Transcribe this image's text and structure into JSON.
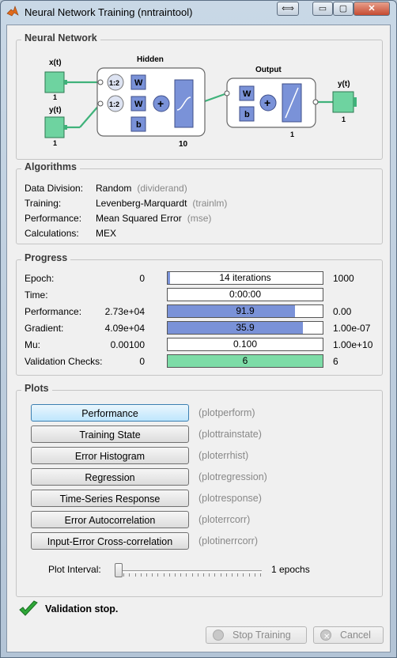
{
  "window": {
    "title": "Neural Network Training (nntraintool)",
    "controls": {
      "restore": "⟺",
      "minimize": "▭",
      "maximize": "▢",
      "close": "✕"
    }
  },
  "network": {
    "panel_title": "Neural Network",
    "input1_label": "x(t)",
    "input1_size": "1",
    "input2_label": "y(t)",
    "input2_size": "1",
    "hidden_title": "Hidden",
    "hidden_size": "10",
    "delay1": "1:2",
    "delay2": "1:2",
    "w_hidden_1": "W",
    "w_hidden_2": "W",
    "b_hidden": "b",
    "sum_hidden": "+",
    "output_title": "Output",
    "output_size": "1",
    "w_output": "W",
    "b_output": "b",
    "sum_output": "+",
    "output_label": "y(t)",
    "output_dim": "1"
  },
  "algorithms": {
    "panel_title": "Algorithms",
    "rows": [
      {
        "label": "Data Division:",
        "value": "Random",
        "fn": "(dividerand)"
      },
      {
        "label": "Training:",
        "value": "Levenberg-Marquardt",
        "fn": "(trainlm)"
      },
      {
        "label": "Performance:",
        "value": "Mean Squared Error",
        "fn": "(mse)"
      },
      {
        "label": "Calculations:",
        "value": "MEX",
        "fn": ""
      }
    ]
  },
  "progress": {
    "panel_title": "Progress",
    "rows": [
      {
        "label": "Epoch:",
        "start": "0",
        "value": "14 iterations",
        "end": "1000",
        "fill": 0.014,
        "color": "#7a92d8"
      },
      {
        "label": "Time:",
        "start": "",
        "value": "0:00:00",
        "end": "",
        "fill": 0,
        "color": "#7a92d8"
      },
      {
        "label": "Performance:",
        "start": "2.73e+04",
        "value": "91.9",
        "end": "0.00",
        "fill": 0.82,
        "color": "#7a92d8"
      },
      {
        "label": "Gradient:",
        "start": "4.09e+04",
        "value": "35.9",
        "end": "1.00e-07",
        "fill": 0.87,
        "color": "#7a92d8"
      },
      {
        "label": "Mu:",
        "start": "0.00100",
        "value": "0.100",
        "end": "1.00e+10",
        "fill": 0,
        "color": "#7a92d8"
      },
      {
        "label": "Validation Checks:",
        "start": "0",
        "value": "6",
        "end": "6",
        "fill": 1.0,
        "color": "#7ddca7"
      }
    ]
  },
  "plots": {
    "panel_title": "Plots",
    "buttons": [
      {
        "label": "Performance",
        "fn": "(plotperform)"
      },
      {
        "label": "Training State",
        "fn": "(plottrainstate)"
      },
      {
        "label": "Error Histogram",
        "fn": "(ploterrhist)"
      },
      {
        "label": "Regression",
        "fn": "(plotregression)"
      },
      {
        "label": "Time-Series Response",
        "fn": "(plotresponse)"
      },
      {
        "label": "Error Autocorrelation",
        "fn": "(ploterrcorr)"
      },
      {
        "label": "Input-Error Cross-correlation",
        "fn": "(plotinerrcorr)"
      }
    ],
    "interval_label": "Plot Interval:",
    "interval_value": "1 epochs",
    "interval_fraction": 0.0
  },
  "status": {
    "icon": "checkmark-icon",
    "text": "Validation stop."
  },
  "actions": {
    "stop_label": "Stop Training",
    "cancel_label": "Cancel"
  },
  "colors": {
    "accent": "#7a92d8",
    "valid": "#7ddca7",
    "node": "#6ed3a0"
  }
}
